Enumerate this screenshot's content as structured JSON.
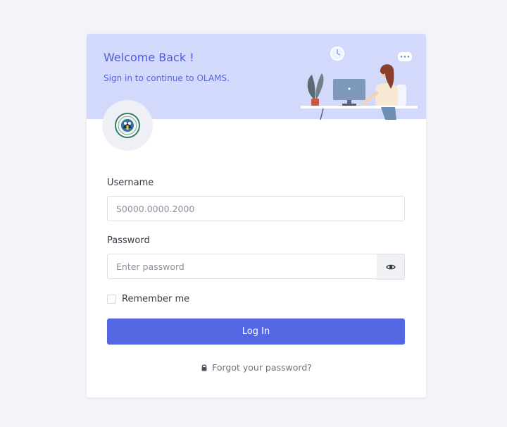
{
  "header": {
    "title": "Welcome Back !",
    "subtitle": "Sign in to continue to OLAMS."
  },
  "logo": {
    "icon": "organization-seal"
  },
  "form": {
    "username_label": "Username",
    "username_value": "S0000.0000.2000",
    "password_label": "Password",
    "password_placeholder": "Enter password",
    "password_toggle_icon": "eye-icon",
    "remember_label": "Remember me",
    "remember_checked": false,
    "login_label": "Log In",
    "forgot_label": "Forgot your password?",
    "forgot_icon": "lock-icon"
  },
  "colors": {
    "header_bg": "#d3d9fb",
    "accent": "#5468e3",
    "title": "#4f5fd6"
  }
}
